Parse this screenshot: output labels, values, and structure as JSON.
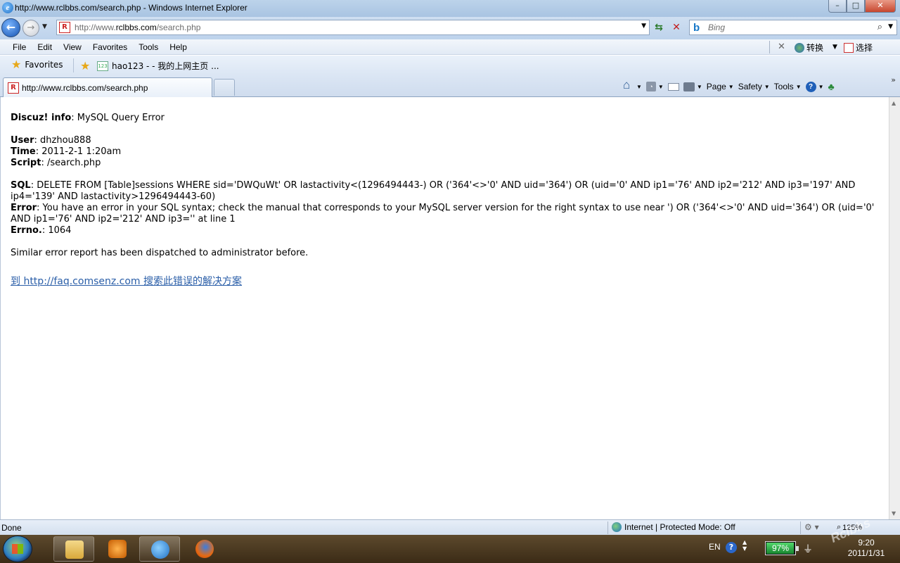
{
  "window": {
    "title": "http://www.rclbbs.com/search.php - Windows Internet Explorer",
    "minimize_glyph": "–",
    "maximize_glyph": "□",
    "close_glyph": "✕"
  },
  "address_bar": {
    "url_prefix": "http://www.",
    "url_domain": "rclbbs.com",
    "url_suffix": "/search.php"
  },
  "search": {
    "placeholder": "Bing"
  },
  "menu": {
    "items": [
      "File",
      "Edit",
      "View",
      "Favorites",
      "Tools",
      "Help"
    ],
    "translate_label": "转换",
    "select_label": "选择"
  },
  "favorites_bar": {
    "favorites_label": "Favorites",
    "item_label": "hao123 - - 我的上网主页 ..."
  },
  "tabs": [
    {
      "label": "http://www.rclbbs.com/search.php"
    }
  ],
  "command_bar": {
    "page_label": "Page",
    "safety_label": "Safety",
    "tools_label": "Tools"
  },
  "page": {
    "header_label": "Discuz! info",
    "header_text": ": MySQL Query Error",
    "user_label": "User",
    "user_value": ": dhzhou888",
    "time_label": "Time",
    "time_value": ": 2011-2-1 1:20am",
    "script_label": "Script",
    "script_value": ": /search.php",
    "sql_label": "SQL",
    "sql_value": ": DELETE FROM [Table]sessions WHERE sid='DWQuWt' OR lastactivity<(1296494443-) OR ('364'<>'0' AND uid='364') OR (uid='0' AND ip1='76' AND ip2='212' AND ip3='197' AND ip4='139' AND lastactivity>1296494443-60)",
    "error_label": "Error",
    "error_value": ": You have an error in your SQL syntax; check the manual that corresponds to your MySQL server version for the right syntax to use near ') OR ('364'<>'0' AND uid='364') OR (uid='0' AND ip1='76' AND ip2='212' AND ip3='' at line 1",
    "errno_label": "Errno.",
    "errno_value": ": 1064",
    "dispatch_note": "Similar error report has been dispatched to administrator before.",
    "faq_link": "到  http://faq.comsenz.com 搜索此错误的解决方案"
  },
  "status_bar": {
    "status": "Done",
    "zone": "Internet | Protected Mode: Off",
    "zoom": "125%"
  },
  "taskbar": {
    "language": "EN",
    "battery_percent": 97,
    "battery_label": "97%",
    "time": "9:20",
    "date": "2011/1/31"
  },
  "watermark": "Rclbbs",
  "icons": {
    "back": "back-arrow-icon",
    "forward": "forward-arrow-icon",
    "refresh": "refresh-icon",
    "stop": "stop-icon",
    "search": "magnifier-icon",
    "home": "home-icon",
    "feeds": "rss-icon",
    "mail": "mail-icon",
    "print": "printer-icon",
    "help": "help-icon"
  },
  "colors": {
    "link": "#2a5ea8",
    "titlebar": "#bcd3ea",
    "close_button": "#c7472f",
    "taskbar": "#4a3920"
  }
}
